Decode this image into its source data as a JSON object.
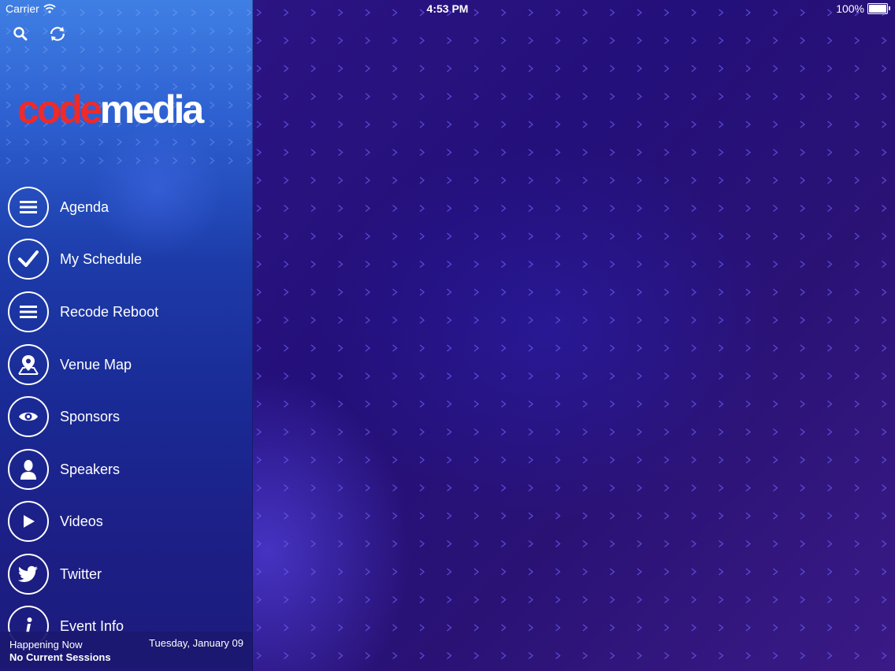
{
  "status_bar": {
    "carrier": "Carrier",
    "time": "4:53 PM",
    "battery": "100%",
    "battery_level": 1.0
  },
  "toolbar": {
    "search_icon": "search-icon",
    "refresh_icon": "refresh-icon"
  },
  "logo": {
    "part1": "code",
    "part2": "media"
  },
  "menu": [
    {
      "label": "Agenda",
      "icon": "list-icon"
    },
    {
      "label": "My Schedule",
      "icon": "checkmark-icon"
    },
    {
      "label": "Recode Reboot",
      "icon": "list-icon"
    },
    {
      "label": "Venue Map",
      "icon": "map-pin-icon"
    },
    {
      "label": "Sponsors",
      "icon": "eye-icon"
    },
    {
      "label": "Speakers",
      "icon": "person-icon"
    },
    {
      "label": "Videos",
      "icon": "play-icon"
    },
    {
      "label": "Twitter",
      "icon": "twitter-icon"
    },
    {
      "label": "Event Info",
      "icon": "info-icon"
    }
  ],
  "footer": {
    "happening_label": "Happening Now",
    "sessions_text": "No Current Sessions",
    "date": "Tuesday, January 09"
  },
  "colors": {
    "logo_red": "#ee2a2a",
    "sidebar_top": "#3f7fe4",
    "main_bg": "#2a1370",
    "chevron": "#6a5cf0"
  }
}
